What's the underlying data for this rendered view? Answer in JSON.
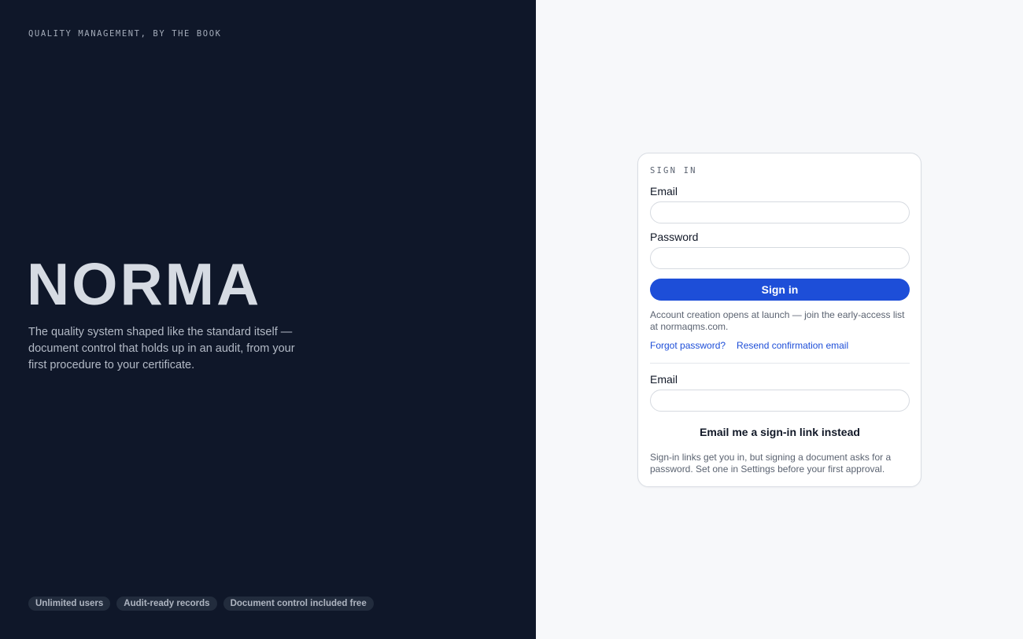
{
  "hero": {
    "tagline": "QUALITY MANAGEMENT, BY THE BOOK",
    "brand": "NORMA",
    "description": "The quality system shaped like the standard itself — document control that holds up in an audit, from your first procedure to your certificate.",
    "chips": [
      "Unlimited users",
      "Audit-ready records",
      "Document control included free"
    ]
  },
  "signin": {
    "title": "SIGN IN",
    "email_label": "Email",
    "email_value": "",
    "password_label": "Password",
    "password_value": "",
    "submit_label": "Sign in",
    "account_note": "Account creation opens at launch — join the early-access list at normaqms.com.",
    "forgot_link": "Forgot password?",
    "resend_link": "Resend confirmation email"
  },
  "magic_link": {
    "email_label": "Email",
    "email_value": "",
    "button_label": "Email me a sign-in link instead",
    "note": "Sign-in links get you in, but signing a document asks for a password. Set one in Settings before your first approval."
  },
  "colors": {
    "left_panel_bg": "#0f1729",
    "right_panel_bg": "#f7f8fa",
    "accent": "#1d4ed8"
  }
}
